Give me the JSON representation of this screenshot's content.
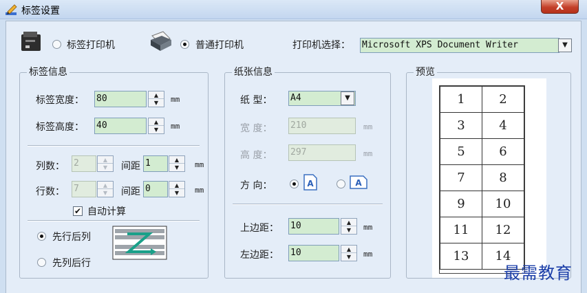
{
  "window": {
    "title": "标签设置",
    "close_label": "X"
  },
  "printer_type": {
    "label_printer_label": "标签打印机",
    "normal_printer_label": "普通打印机",
    "selected": "normal",
    "printer_select_label": "打印机选择：",
    "printer_select_value": "Microsoft XPS Document Writer"
  },
  "label_info": {
    "title": "标签信息",
    "width_label": "标签宽度：",
    "width_value": "80",
    "height_label": "标签高度：",
    "height_value": "40",
    "unit": "mm",
    "columns_label": "列数：",
    "columns_value": "2",
    "col_gap_label": "间距",
    "col_gap_value": "1",
    "rows_label": "行数：",
    "rows_value": "7",
    "row_gap_label": "间距",
    "row_gap_value": "0",
    "auto_calc_label": "自动计算",
    "auto_calc_checked": true,
    "order_row_first_label": "先行后列",
    "order_col_first_label": "先列后行",
    "order_selected": "row_first"
  },
  "paper_info": {
    "title": "纸张信息",
    "type_label": "纸  型：",
    "type_value": "A4",
    "width_label": "宽  度：",
    "width_value": "210",
    "height_label": "高  度：",
    "height_value": "297",
    "unit": "mm",
    "orientation_label": "方  向：",
    "orientation_selected": "portrait",
    "top_margin_label": "上边距：",
    "top_margin_value": "10",
    "left_margin_label": "左边距：",
    "left_margin_value": "10"
  },
  "preview": {
    "title": "预览",
    "cells": [
      "1",
      "2",
      "3",
      "4",
      "5",
      "6",
      "7",
      "8",
      "9",
      "10",
      "11",
      "12",
      "13",
      "14"
    ]
  },
  "watermark": "最需教育",
  "colors": {
    "input_bg": "#d3ecd1",
    "panel_bg": "#e4edf8",
    "close_red": "#c4402a",
    "watermark_blue": "#1b3ea8"
  }
}
